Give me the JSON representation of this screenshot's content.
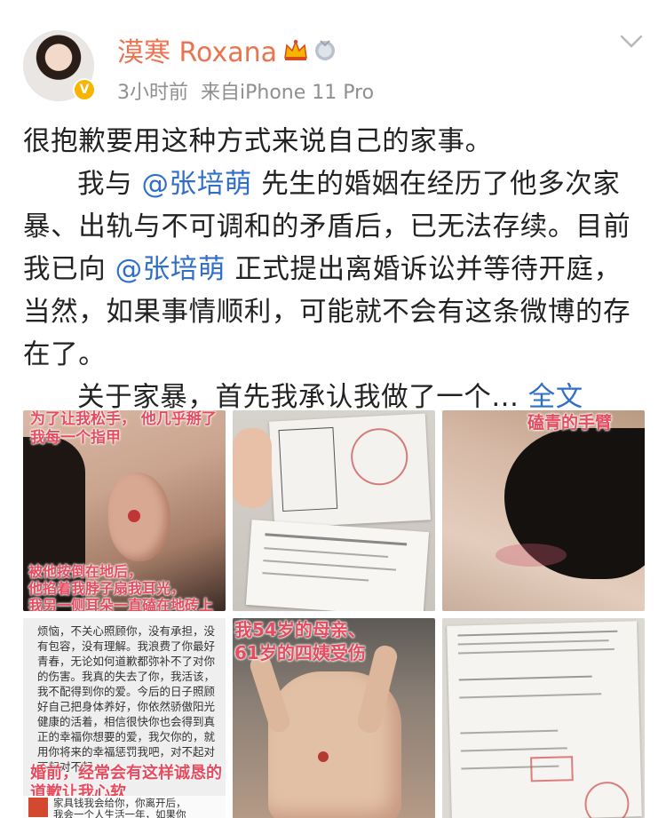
{
  "header": {
    "username": "漠寒 Roxana",
    "time": "3小时前",
    "source": "来自iPhone 11 Pro"
  },
  "content": {
    "p1": "很抱歉要用这种方式来说自己的家事。",
    "p2_a": "我与",
    "p2_mention1": "@张培萌",
    "p2_b": "先生的婚姻在经历了他多次家暴、出轨与不可调和的矛盾后，已无法存续。目前我已向",
    "p2_mention2": "@张培萌",
    "p2_c": "正式提出离婚诉讼并等待开庭，当然，如果事情顺利，可能就不会有这条微博的存在了。",
    "p3": "关于家暴，首先我承认我做了一个...",
    "more": "全文"
  },
  "images": {
    "img1_top": "为了让我松手，\n他几乎掰了我每一个指甲",
    "img1_bottom": "被他按倒在地后，\n他掐着我脖子扇我耳光，\n我另一侧耳朵一直磕在地砖上",
    "img3_top": "磕青的手臂",
    "img4_chat": "烦恼，不关心照顾你，没有承担，没有包容，没有理解。我浪费了你最好青春，无论如何道歉都弥补不了对你的伤害。我真的失去了你，我活该，我不配得到你的爱。今后的日子照顾好自己把身体养好，你依然骄傲阳光健康的活着，相信很快你也会得到真正的幸福你想要的爱，我欠你的，就用你将来的幸福惩罚我吧，对不起对不起对不起…",
    "img4_caption": "婚前，经常会有这样诚恳的\n道歉让我心软",
    "img4_bottom": "家具钱我会给你，你离开后，\n我会一个人生活一年，如果你",
    "img5_top": "我54岁的母亲、\n61岁的四姨受伤"
  },
  "colors": {
    "username": "#eb7350",
    "link": "#2f6ec9",
    "meta": "#8f8f8f",
    "caption": "#e64b5e"
  }
}
